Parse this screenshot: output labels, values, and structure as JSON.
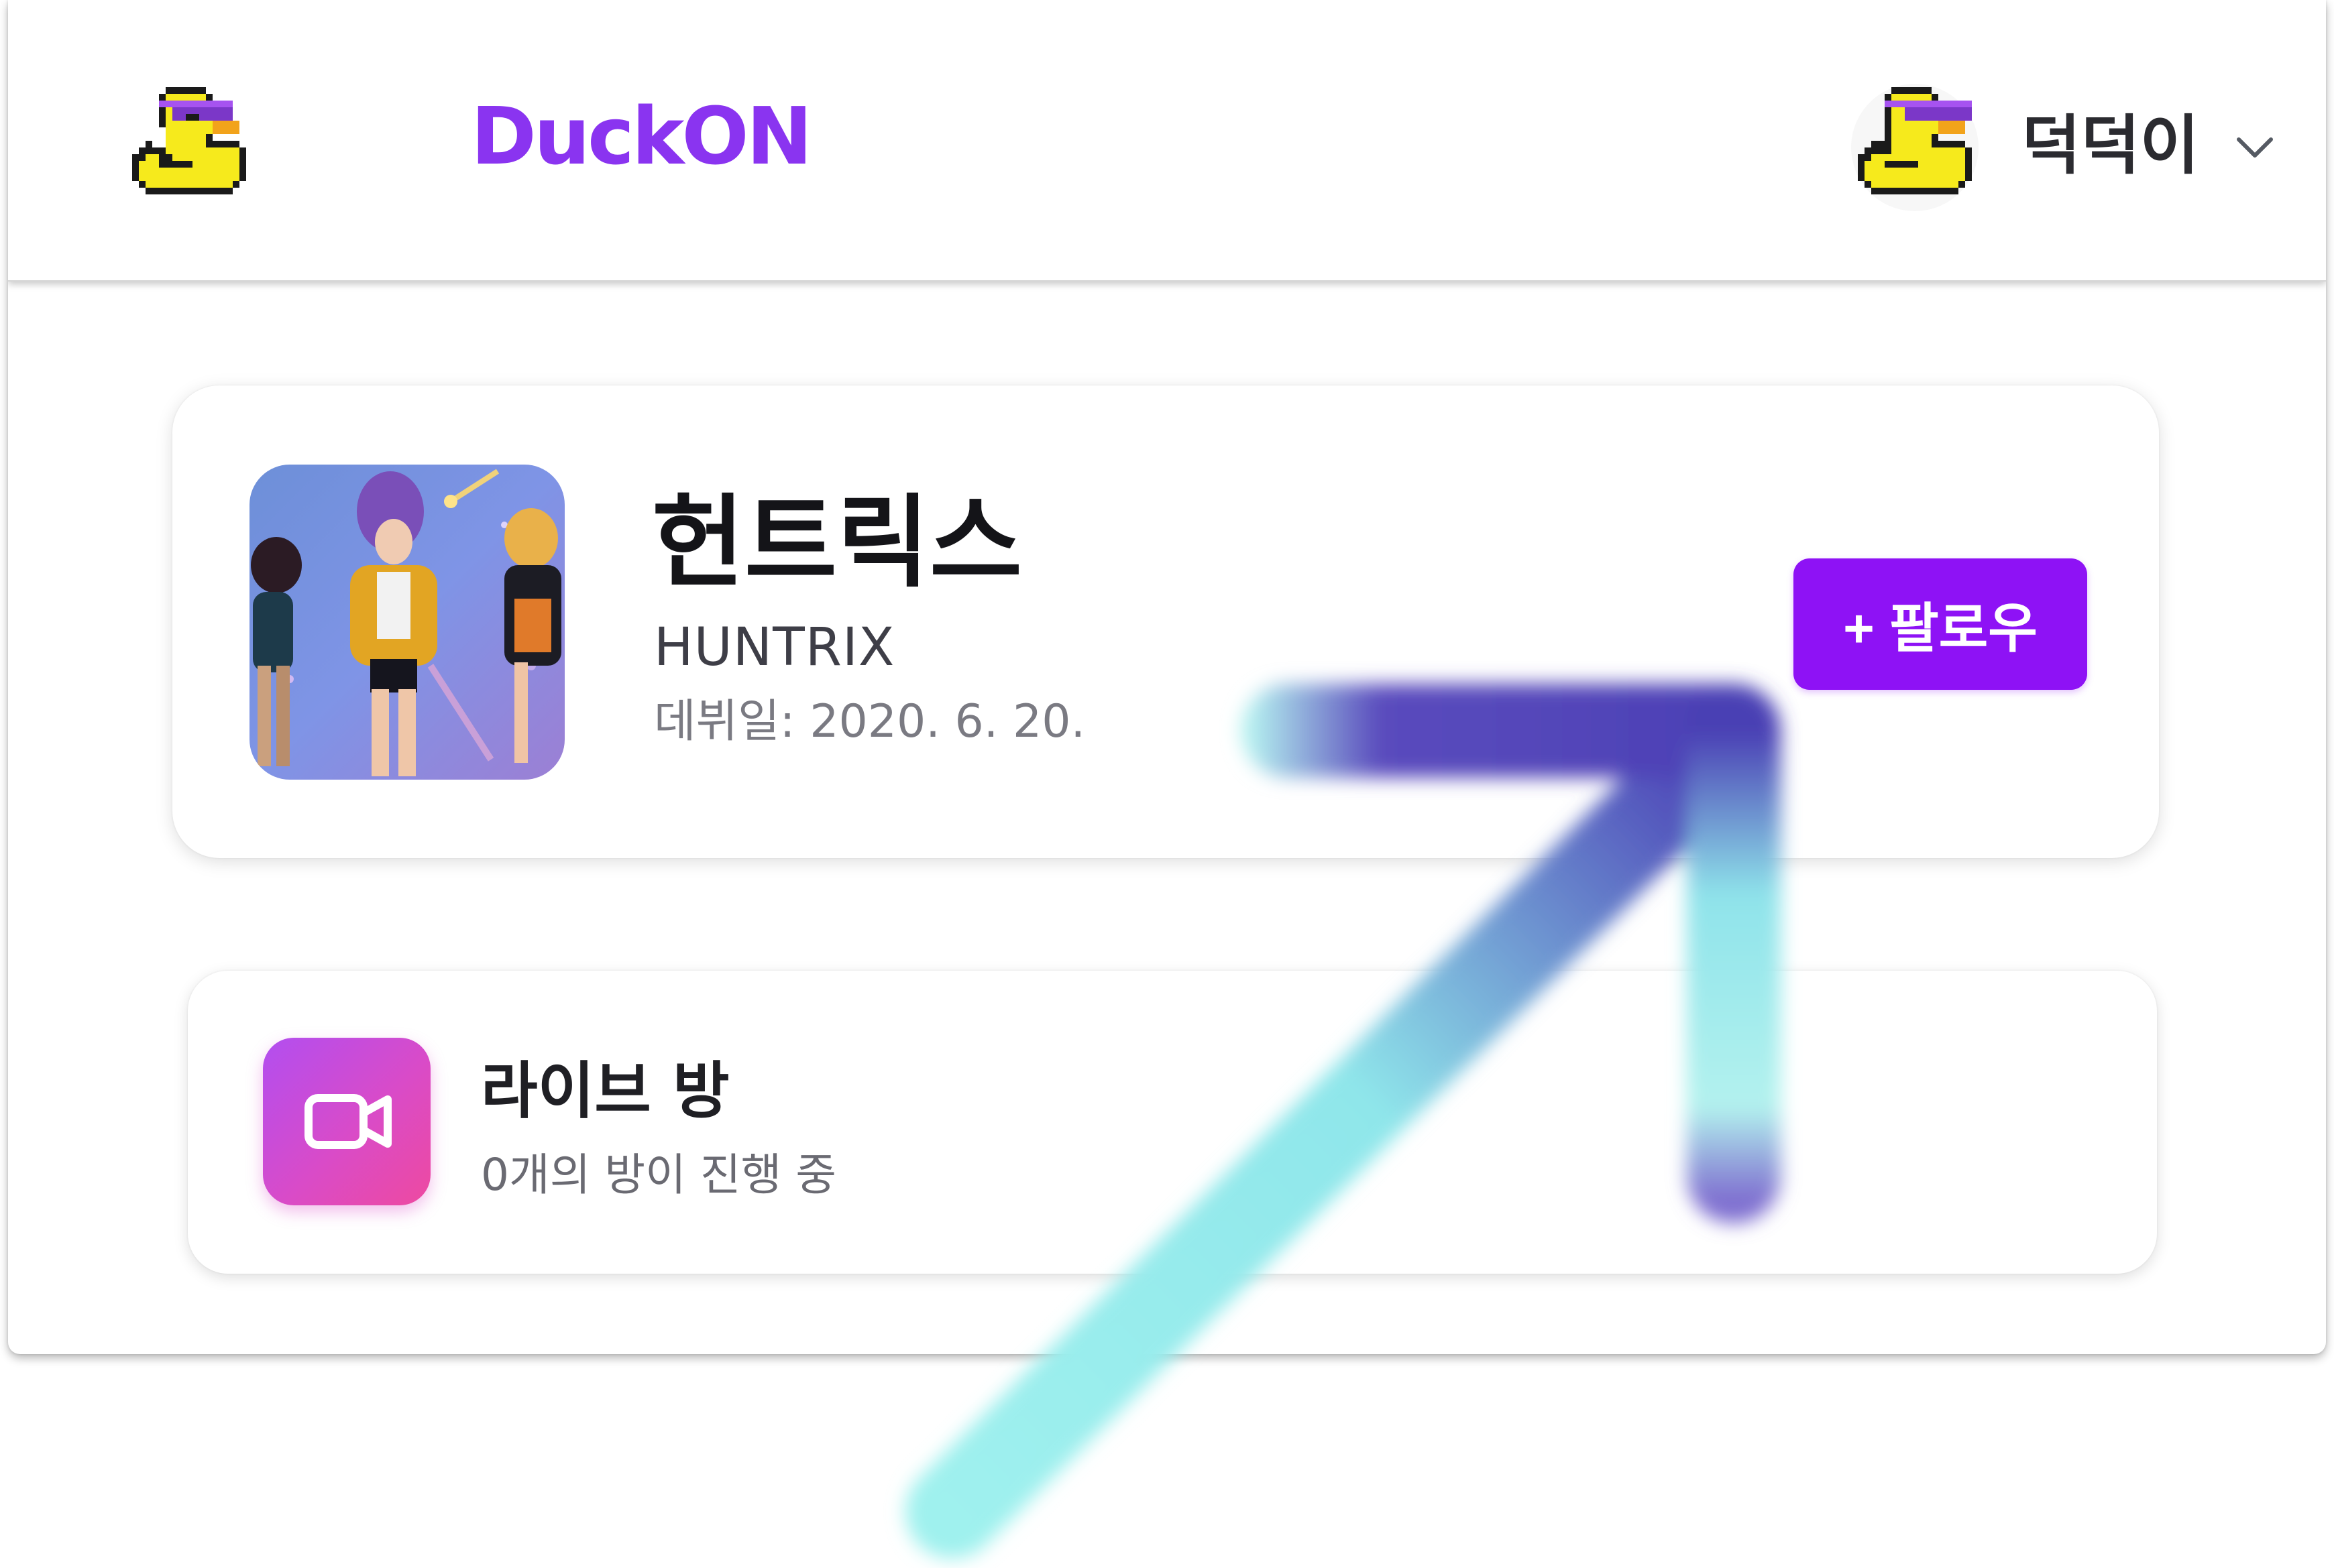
{
  "header": {
    "logo_icon": "pixel-duck-sunglasses-icon",
    "brand": "DuckON",
    "user": {
      "avatar_icon": "pixel-duck-sunglasses-avatar",
      "name": "덕덕이",
      "menu_icon": "chevron-down-icon"
    }
  },
  "artist": {
    "image": "artist-group-photo",
    "name": "헌트릭스",
    "english_name": "HUNTRIX",
    "debut": "데뷔일: 2020. 6. 20.",
    "follow_label": "+ 팔로우"
  },
  "live_rooms": {
    "icon": "video-camera-icon",
    "title": "라이브 방",
    "subtitle": "0개의 방이 진행 중"
  },
  "overlay": {
    "annotation": "arrow-pointing-to-follow-button"
  },
  "colors": {
    "brand": "#8a34f0",
    "follow_button": "#8e12f5",
    "live_icon_gradient": [
      "#b24ef0",
      "#ee4aa0"
    ],
    "arrow_gradient": [
      "#a8f3ef",
      "#4a3fb4"
    ]
  }
}
